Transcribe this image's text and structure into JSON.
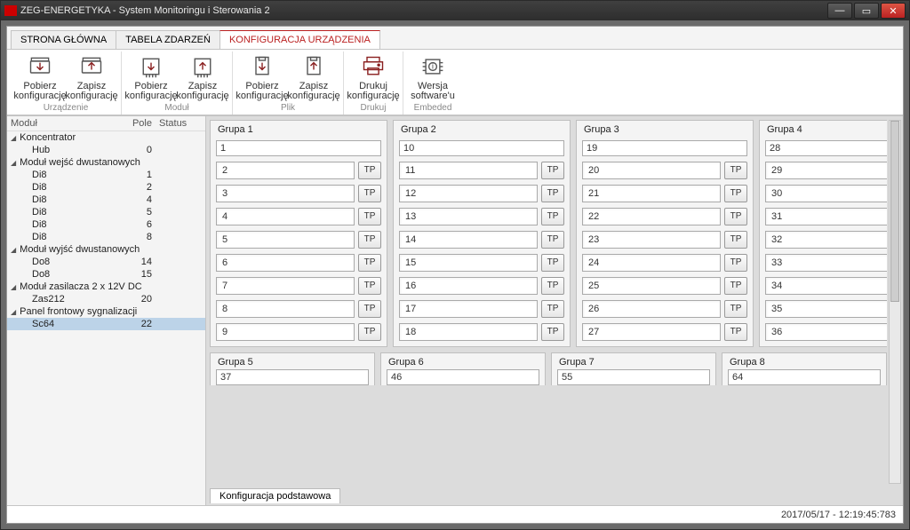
{
  "window": {
    "title": "ZEG-ENERGETYKA - System Monitoringu i Sterowania 2"
  },
  "tabs": [
    {
      "label": "STRONA GŁÓWNA",
      "active": false
    },
    {
      "label": "TABELA ZDARZEŃ",
      "active": false
    },
    {
      "label": "KONFIGURACJA URZĄDZENIA",
      "active": true
    }
  ],
  "ribbon": {
    "groups": [
      {
        "label": "Urządzenie",
        "buttons": [
          {
            "label1": "Pobierz",
            "label2": "konfigurację",
            "icon": "device-download"
          },
          {
            "label1": "Zapisz",
            "label2": "konfigurację",
            "icon": "device-upload"
          }
        ]
      },
      {
        "label": "Moduł",
        "buttons": [
          {
            "label1": "Pobierz",
            "label2": "konfigurację",
            "icon": "module-download"
          },
          {
            "label1": "Zapisz",
            "label2": "konfigurację",
            "icon": "module-upload"
          }
        ]
      },
      {
        "label": "Plik",
        "buttons": [
          {
            "label1": "Pobierz",
            "label2": "konfigurację",
            "icon": "file-download"
          },
          {
            "label1": "Zapisz",
            "label2": "konfigurację",
            "icon": "file-upload"
          }
        ]
      },
      {
        "label": "Drukuj",
        "buttons": [
          {
            "label1": "Drukuj",
            "label2": "konfigurację",
            "icon": "printer"
          }
        ]
      },
      {
        "label": "Embeded",
        "buttons": [
          {
            "label1": "Wersja",
            "label2": "software'u",
            "icon": "chip-info"
          }
        ]
      }
    ]
  },
  "sidebar": {
    "headers": {
      "c1": "Moduł",
      "c2": "Pole",
      "c3": "Status"
    },
    "tree": [
      {
        "type": "group",
        "name": "Koncentrator"
      },
      {
        "type": "leaf",
        "name": "Hub",
        "pole": "0"
      },
      {
        "type": "group",
        "name": "Moduł wejść dwustanowych"
      },
      {
        "type": "leaf",
        "name": "Di8",
        "pole": "1"
      },
      {
        "type": "leaf",
        "name": "Di8",
        "pole": "2"
      },
      {
        "type": "leaf",
        "name": "Di8",
        "pole": "4"
      },
      {
        "type": "leaf",
        "name": "Di8",
        "pole": "5"
      },
      {
        "type": "leaf",
        "name": "Di8",
        "pole": "6"
      },
      {
        "type": "leaf",
        "name": "Di8",
        "pole": "8"
      },
      {
        "type": "group",
        "name": "Moduł wyjść dwustanowych"
      },
      {
        "type": "leaf",
        "name": "Do8",
        "pole": "14"
      },
      {
        "type": "leaf",
        "name": "Do8",
        "pole": "15"
      },
      {
        "type": "group",
        "name": "Moduł zasilacza 2 x 12V DC"
      },
      {
        "type": "leaf",
        "name": "Zas212",
        "pole": "20"
      },
      {
        "type": "group",
        "name": "Panel frontowy sygnalizacji"
      },
      {
        "type": "leaf",
        "name": "Sc64",
        "pole": "22",
        "selected": true
      }
    ]
  },
  "content": {
    "groups": [
      {
        "title": "Grupa 1",
        "first": "1",
        "rows": [
          "2",
          "3",
          "4",
          "5",
          "6",
          "7",
          "8",
          "9"
        ]
      },
      {
        "title": "Grupa 2",
        "first": "10",
        "rows": [
          "11",
          "12",
          "13",
          "14",
          "15",
          "16",
          "17",
          "18"
        ]
      },
      {
        "title": "Grupa 3",
        "first": "19",
        "rows": [
          "20",
          "21",
          "22",
          "23",
          "24",
          "25",
          "26",
          "27"
        ]
      },
      {
        "title": "Grupa 4",
        "first": "28",
        "rows": [
          "29",
          "30",
          "31",
          "32",
          "33",
          "34",
          "35",
          "36"
        ]
      }
    ],
    "overflow": [
      {
        "title": "Grupa 5",
        "first": "37"
      },
      {
        "title": "Grupa 6",
        "first": "46"
      },
      {
        "title": "Grupa 7",
        "first": "55"
      },
      {
        "title": "Grupa 8",
        "first": "64"
      }
    ],
    "tp": "TP",
    "bottom_tab": "Konfiguracja podstawowa"
  },
  "status": {
    "text": "2017/05/17 - 12:19:45:783"
  }
}
